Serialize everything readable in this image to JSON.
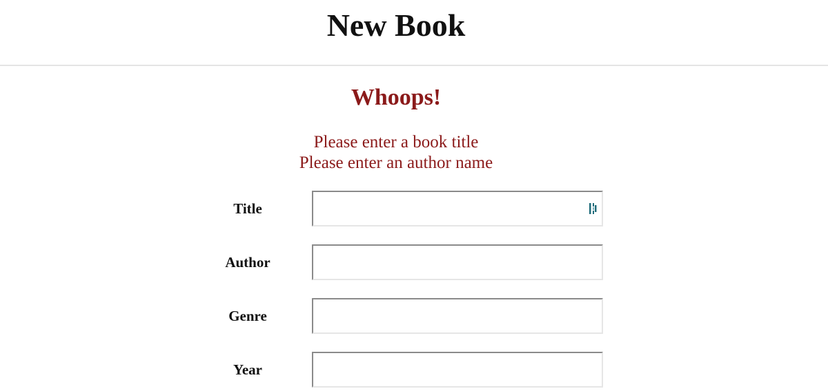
{
  "header": {
    "title": "New Book"
  },
  "errors": {
    "heading": "Whoops!",
    "messages": [
      "Please enter a book title",
      "Please enter an author name"
    ],
    "color": "#8b1a1a"
  },
  "form": {
    "fields": [
      {
        "label": "Title",
        "value": "",
        "icon": "password-manager-icon"
      },
      {
        "label": "Author",
        "value": ""
      },
      {
        "label": "Genre",
        "value": ""
      },
      {
        "label": "Year",
        "value": ""
      }
    ]
  }
}
